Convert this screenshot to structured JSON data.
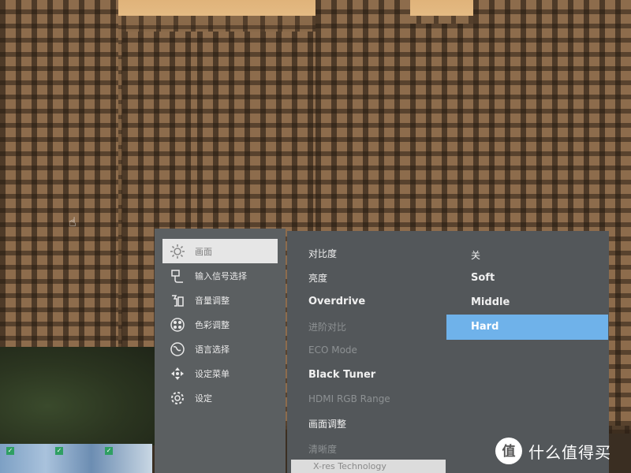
{
  "osd": {
    "menu": [
      {
        "label": "画面",
        "icon": "sun-icon",
        "selected": true
      },
      {
        "label": "输入信号选择",
        "icon": "input-icon"
      },
      {
        "label": "音量调整",
        "icon": "audio-icon"
      },
      {
        "label": "色彩调整",
        "icon": "color-icon"
      },
      {
        "label": "语言选择",
        "icon": "globe-icon"
      },
      {
        "label": "设定菜单",
        "icon": "menu-settings-icon"
      },
      {
        "label": "设定",
        "icon": "gear-icon"
      }
    ],
    "submenu": [
      {
        "label": "对比度"
      },
      {
        "label": "亮度"
      },
      {
        "label": "Overdrive"
      },
      {
        "label": "进阶对比"
      },
      {
        "label": "ECO Mode"
      },
      {
        "label": "Black Tuner"
      },
      {
        "label": "HDMI RGB Range"
      },
      {
        "label": "画面调整"
      },
      {
        "label": "清晰度"
      },
      {
        "label": "X-res Technology"
      }
    ],
    "options": [
      {
        "label": "关"
      },
      {
        "label": "Soft"
      },
      {
        "label": "Middle"
      },
      {
        "label": "Hard",
        "selected": true
      }
    ]
  },
  "watermark": {
    "text": "什么值得买",
    "logo_glyph": "值"
  },
  "colors": {
    "osd_left": "#5b5f61",
    "osd_right": "#53575a",
    "selection": "#6fb2ea",
    "nav_selected": "#e6e6e6"
  }
}
